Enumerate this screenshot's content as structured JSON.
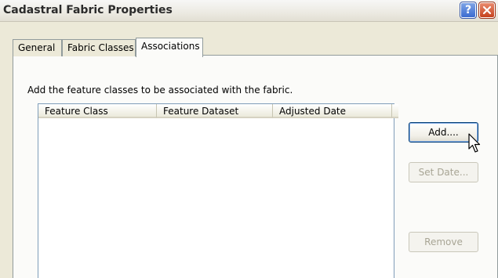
{
  "window": {
    "title": "Cadastral Fabric Properties"
  },
  "titlebar_buttons": {
    "help_label": "?",
    "close_icon": "close-icon"
  },
  "tabs": [
    {
      "label": "General",
      "active": false
    },
    {
      "label": "Fabric Classes",
      "active": false
    },
    {
      "label": "Associations",
      "active": true
    }
  ],
  "associations": {
    "instructions": "Add the feature classes to be associated with the fabric.",
    "columns": [
      "Feature Class",
      "Feature Dataset",
      "Adjusted Date"
    ],
    "rows": []
  },
  "buttons": {
    "add": "Add....",
    "set_date": "Set Date...",
    "remove": "Remove"
  },
  "colors": {
    "title_text": "#2b2b2b",
    "list_border": "#7f9db9",
    "disabled_text": "#a8a595"
  }
}
